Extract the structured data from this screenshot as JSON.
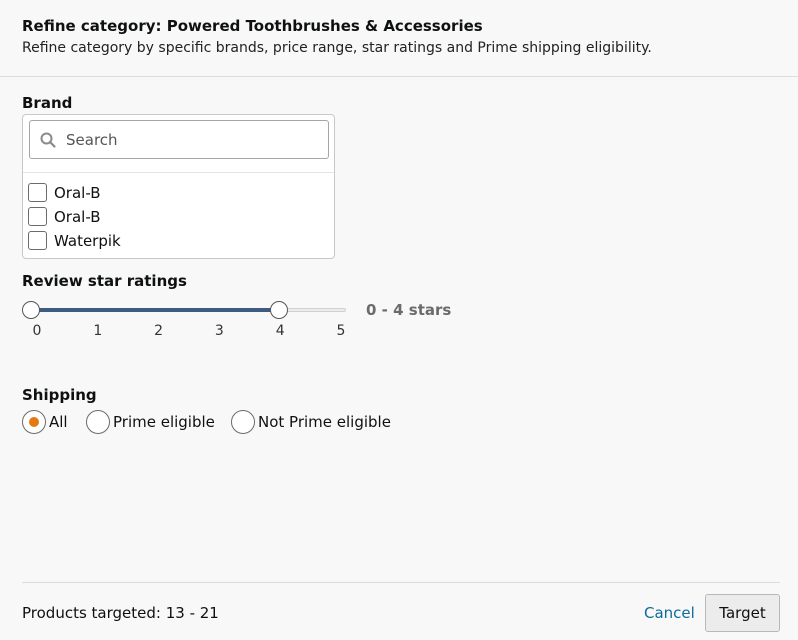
{
  "header": {
    "title": "Refine category: Powered Toothbrushes & Accessories",
    "subtitle": "Refine category by specific brands, price range, star ratings and Prime shipping eligibility."
  },
  "brand": {
    "label": "Brand",
    "search_placeholder": "Search",
    "search_icon": "search-icon",
    "items": [
      {
        "label": "Oral-B",
        "checked": false
      },
      {
        "label": "Oral-B",
        "checked": false
      },
      {
        "label": "Waterpik",
        "checked": false
      }
    ]
  },
  "rating": {
    "label": "Review star ratings",
    "min": 0,
    "max": 5,
    "selected_min": 0,
    "selected_max": 4,
    "ticks": [
      "0",
      "1",
      "2",
      "3",
      "4",
      "5"
    ],
    "range_label": "0 - 4 stars",
    "fill_color": "#3e5c82"
  },
  "shipping": {
    "label": "Shipping",
    "options": [
      {
        "label": "All",
        "checked": true
      },
      {
        "label": "Prime eligible",
        "checked": false
      },
      {
        "label": "Not Prime eligible",
        "checked": false
      }
    ],
    "selected_color": "#e47911"
  },
  "footer": {
    "products_targeted": "Products targeted: 13 - 21",
    "cancel_label": "Cancel",
    "target_label": "Target",
    "link_color": "#0d6a9e"
  }
}
